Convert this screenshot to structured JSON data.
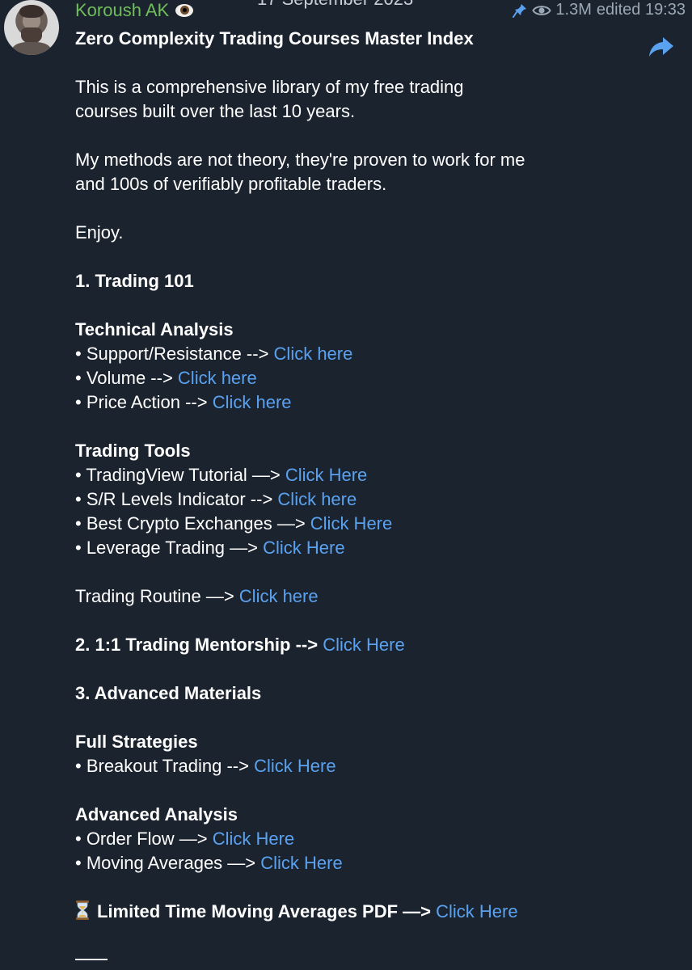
{
  "header": {
    "date_label": "17 September 2023",
    "sender_name": "Koroush AK",
    "sender_emoji_icon": "eye-emoji",
    "views": "1.3M",
    "edited_label": "edited 19:33",
    "pin_icon": "pin-icon",
    "views_icon": "eye-icon",
    "share_icon": "share-arrow-icon"
  },
  "message": {
    "title": "Zero Complexity Trading Courses Master Index",
    "intro_line1": "This is a comprehensive library of my free trading",
    "intro_line2": "courses built over the last 10 years.",
    "methods_line1": "My methods are not theory, they're proven to work for me",
    "methods_line2": "and 100s of verifiably profitable traders.",
    "enjoy": "Enjoy.",
    "section1": "1. Trading 101",
    "technical_analysis": {
      "heading": "Technical Analysis",
      "items": [
        {
          "text": "• Support/Resistance --> ",
          "link": "Click here"
        },
        {
          "text": "• Volume --> ",
          "link": "Click here"
        },
        {
          "text": "• Price Action --> ",
          "link": "Click here"
        }
      ]
    },
    "trading_tools": {
      "heading": "Trading Tools",
      "items": [
        {
          "text": "• TradingView Tutorial —> ",
          "link": "Click Here"
        },
        {
          "text": "• S/R Levels Indicator --> ",
          "link": "Click here"
        },
        {
          "text": "• Best Crypto Exchanges —> ",
          "link": "Click Here"
        },
        {
          "text": "• Leverage Trading —> ",
          "link": "Click Here"
        }
      ]
    },
    "routine": {
      "text": "Trading Routine —> ",
      "link": "Click here"
    },
    "section2": {
      "text": "2. 1:1 Trading Mentorship --> ",
      "link": "Click Here"
    },
    "section3": "3. Advanced Materials",
    "full_strategies": {
      "heading": "Full Strategies",
      "items": [
        {
          "text": "• Breakout Trading --> ",
          "link": "Click Here"
        }
      ]
    },
    "advanced_analysis": {
      "heading": "Advanced Analysis",
      "items": [
        {
          "text": "• Order Flow —> ",
          "link": "Click Here"
        },
        {
          "text": "• Moving Averages —> ",
          "link": "Click Here"
        }
      ]
    },
    "limited": {
      "icon": "hourglass-icon",
      "text": "Limited Time Moving Averages PDF —> ",
      "link": "Click Here"
    }
  },
  "colors": {
    "background": "#1b232f",
    "text": "#ffffff",
    "link": "#5aa2f0",
    "sender_name": "#6fbe5a",
    "meta": "#9aa7b4"
  }
}
